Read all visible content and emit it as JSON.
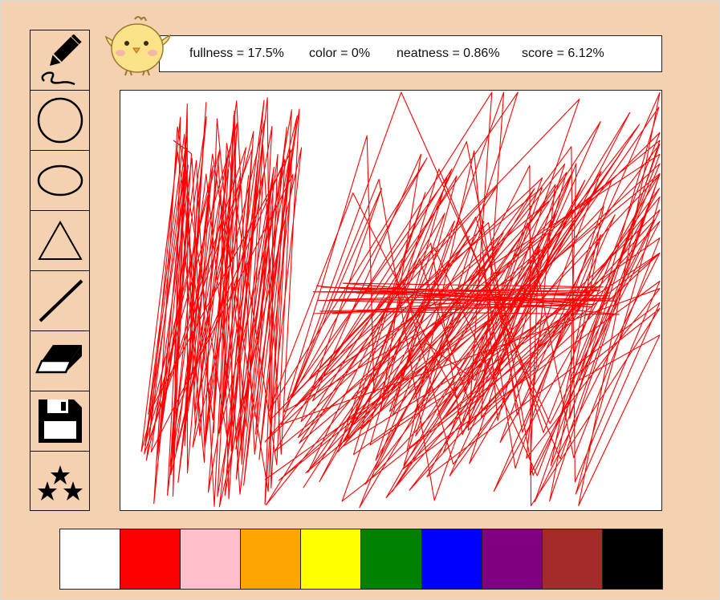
{
  "stats": {
    "fullness": "fullness = 17.5%",
    "color": "color = 0%",
    "neatness": "neatness = 0.86%",
    "score": "score = 6.12%"
  },
  "tools": [
    {
      "name": "pencil-tool-button",
      "icon": "pencil-icon"
    },
    {
      "name": "circle-tool-button",
      "icon": "circle-icon"
    },
    {
      "name": "ellipse-tool-button",
      "icon": "ellipse-icon"
    },
    {
      "name": "triangle-tool-button",
      "icon": "triangle-icon"
    },
    {
      "name": "line-tool-button",
      "icon": "line-icon"
    },
    {
      "name": "eraser-tool-button",
      "icon": "eraser-icon"
    },
    {
      "name": "save-button",
      "icon": "floppy-disk-icon"
    },
    {
      "name": "stars-button",
      "icon": "stars-icon"
    }
  ],
  "palette": [
    "#ffffff",
    "#ff0000",
    "#ffc0cb",
    "#ffa500",
    "#ffff00",
    "#008000",
    "#0000ff",
    "#800080",
    "#a52a2a",
    "#000000"
  ],
  "stroke_color": "#ff0000",
  "mascot": "yellow-chick-icon"
}
